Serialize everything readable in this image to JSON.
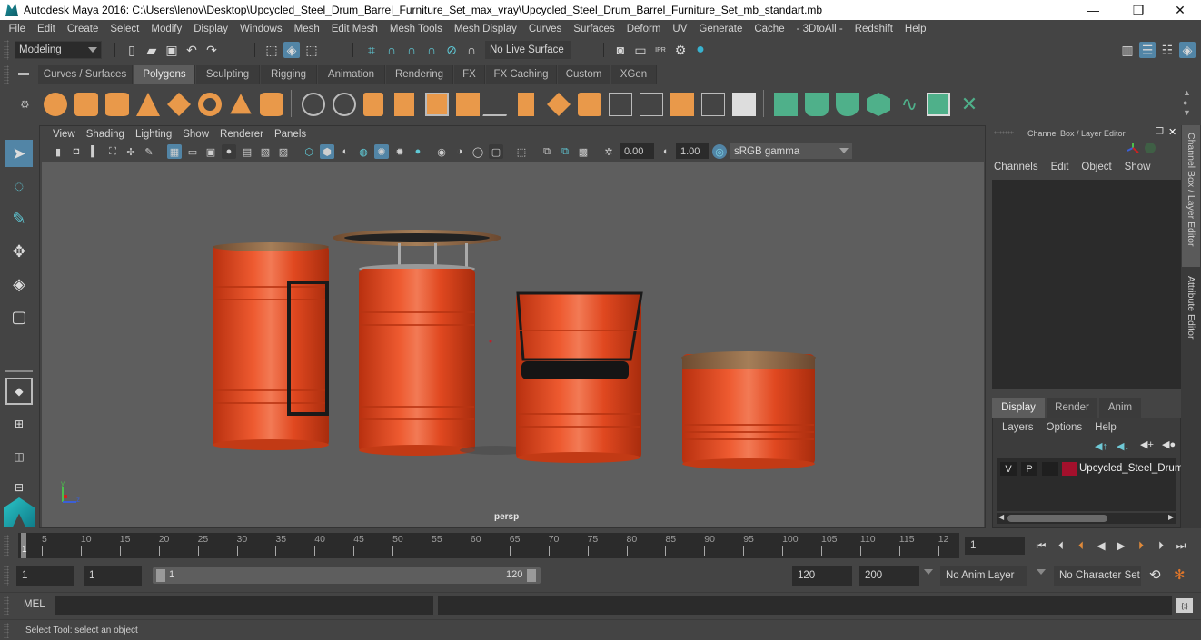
{
  "window": {
    "title": "Autodesk Maya 2016: C:\\Users\\lenov\\Desktop\\Upcycled_Steel_Drum_Barrel_Furniture_Set_max_vray\\Upcycled_Steel_Drum_Barrel_Furniture_Set_mb_standart.mb",
    "controls": {
      "minimize": "—",
      "restore": "❐",
      "close": "✕"
    }
  },
  "menubar": [
    "File",
    "Edit",
    "Create",
    "Select",
    "Modify",
    "Display",
    "Windows",
    "Mesh",
    "Edit Mesh",
    "Mesh Tools",
    "Mesh Display",
    "Curves",
    "Surfaces",
    "Deform",
    "UV",
    "Generate",
    "Cache",
    "- 3DtoAll -",
    "Redshift",
    "Help"
  ],
  "statusline": {
    "workspace_menu": "Modeling",
    "live_surface": "No Live Surface",
    "icons": [
      "new-scene",
      "open-scene",
      "save-scene",
      "undo",
      "redo",
      "select-by-hierarchy",
      "select-by-object-type",
      "select-by-component-type",
      "snap-to-grid",
      "snap-to-curve",
      "snap-to-point",
      "snap-to-view-plane",
      "snap-to-projected-center",
      "make-live",
      "render-current-frame",
      "render-sequence",
      "ipr-render",
      "render-settings",
      "hypershade"
    ],
    "right_icons": [
      "modeling-toolkit",
      "attribute-editor-toggle",
      "tool-settings-toggle",
      "channel-box-toggle"
    ]
  },
  "shelf": {
    "tabs": [
      "Curves / Surfaces",
      "Polygons",
      "Sculpting",
      "Rigging",
      "Animation",
      "Rendering",
      "FX",
      "FX Caching",
      "Custom",
      "XGen"
    ],
    "active_tab": "Polygons",
    "tools": [
      "poly-sphere",
      "poly-cube",
      "poly-cylinder",
      "poly-cone",
      "poly-plane",
      "poly-torus",
      "poly-pyramid",
      "poly-pipe",
      "combine",
      "separate",
      "mirror",
      "smooth",
      "boolean",
      "reduce",
      "multi-cut",
      "extrude",
      "bridge",
      "bevel",
      "insert-edge-loop",
      "offset-edge-loop",
      "append-to-polygon",
      "fill-hole",
      "planar-uv",
      "cylindrical-uv",
      "spherical-uv",
      "automatic-uv",
      "unfold-uv",
      "uv-editor",
      "layout-uv"
    ]
  },
  "toolbox": {
    "tools": [
      "select-tool",
      "lasso-tool",
      "paint-selection-tool",
      "move-tool",
      "rotate-tool",
      "scale-tool"
    ],
    "active_tool": "select-tool",
    "layouts": [
      "single-pane-layout",
      "four-pane-layout",
      "side-by-side-layout",
      "stacked-layout"
    ]
  },
  "viewport": {
    "menus": [
      "View",
      "Shading",
      "Lighting",
      "Show",
      "Renderer",
      "Panels"
    ],
    "exposure": "0.00",
    "gamma": "1.00",
    "color_space": "sRGB gamma",
    "camera_label": "persp",
    "axis": {
      "y": "y",
      "z": "z"
    },
    "colors": {
      "barrel": "#e2461f",
      "wood": "#8a6a4a",
      "background": "#5e5e5e"
    }
  },
  "channel_box": {
    "title": "Channel Box / Layer Editor",
    "menus": [
      "Channels",
      "Edit",
      "Object",
      "Show"
    ]
  },
  "layer_editor": {
    "tabs": [
      "Display",
      "Render",
      "Anim"
    ],
    "active_tab": "Display",
    "menus": [
      "Layers",
      "Options",
      "Help"
    ],
    "layers": [
      {
        "visible": "V",
        "playback": "P",
        "color": "#a3102c",
        "name": "Upcycled_Steel_Drum_"
      }
    ]
  },
  "side_tabs": [
    "Channel Box / Layer Editor",
    "Attribute Editor"
  ],
  "timeslider": {
    "ticks": [
      "5",
      "10",
      "15",
      "20",
      "25",
      "30",
      "35",
      "40",
      "45",
      "50",
      "55",
      "60",
      "65",
      "70",
      "75",
      "80",
      "85",
      "90",
      "95",
      "100",
      "105",
      "110",
      "115",
      "12"
    ],
    "current_marker": "1",
    "current_frame": "1",
    "playback_buttons": [
      "go-to-start",
      "step-back-frame",
      "step-back-key",
      "play-backwards",
      "play-forwards",
      "step-forward-key",
      "step-forward-frame",
      "go-to-end"
    ]
  },
  "rangeslider": {
    "start_time": "1",
    "playback_start": "1",
    "range_start_label": "1",
    "range_end_label": "120",
    "playback_end": "120",
    "end_time": "200",
    "anim_layer": "No Anim Layer",
    "character_set": "No Character Set"
  },
  "cmdline": {
    "label": "MEL",
    "input": "",
    "result": ""
  },
  "helpline": {
    "text": "Select Tool: select an object"
  }
}
